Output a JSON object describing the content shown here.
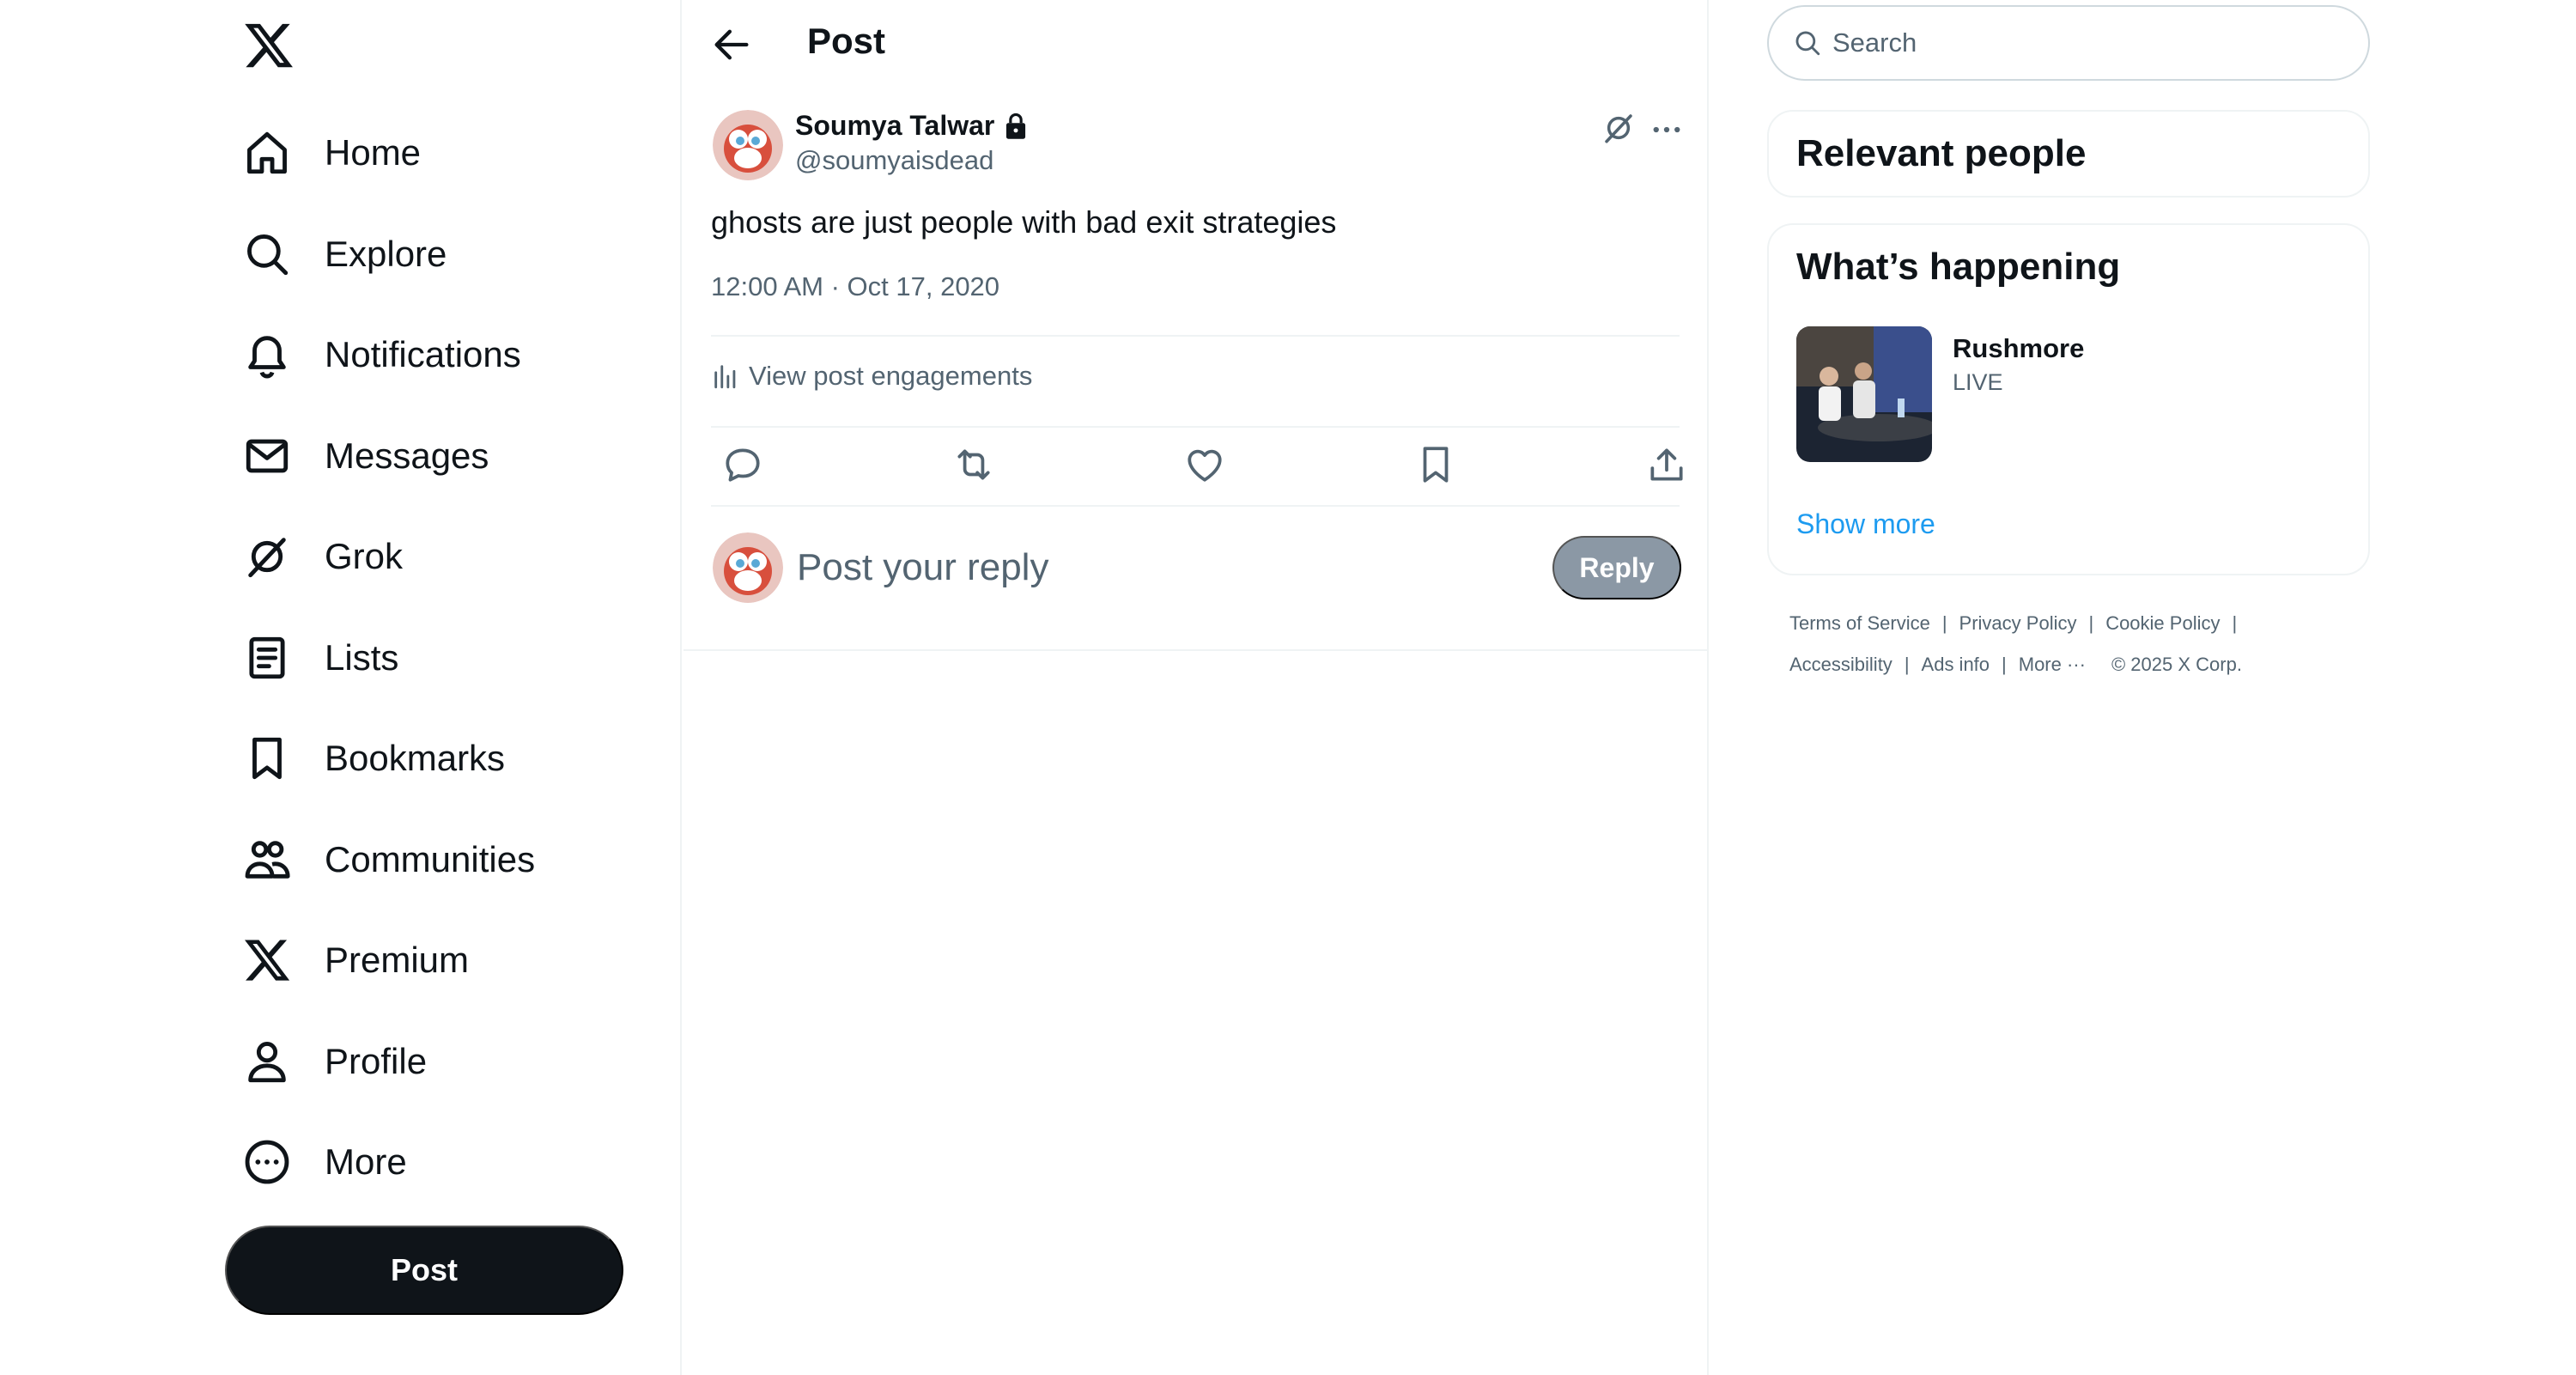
{
  "nav": {
    "items": [
      {
        "label": "Home",
        "icon": "home-icon"
      },
      {
        "label": "Explore",
        "icon": "search-icon"
      },
      {
        "label": "Notifications",
        "icon": "bell-icon"
      },
      {
        "label": "Messages",
        "icon": "envelope-icon"
      },
      {
        "label": "Grok",
        "icon": "grok-icon"
      },
      {
        "label": "Lists",
        "icon": "list-icon"
      },
      {
        "label": "Bookmarks",
        "icon": "bookmark-icon"
      },
      {
        "label": "Communities",
        "icon": "communities-icon"
      },
      {
        "label": "Premium",
        "icon": "x-logo-icon"
      },
      {
        "label": "Profile",
        "icon": "person-icon"
      },
      {
        "label": "More",
        "icon": "more-circle-icon"
      }
    ],
    "post_button": "Post"
  },
  "header": {
    "title": "Post"
  },
  "post": {
    "author_name": "Soumya Talwar",
    "handle": "@soumyaisdead",
    "text": "ghosts are just people with bad exit strategies",
    "timestamp": "12:00 AM · Oct 17, 2020",
    "engagements_label": "View post engagements"
  },
  "reply": {
    "placeholder": "Post your reply",
    "button": "Reply"
  },
  "search": {
    "placeholder": "Search"
  },
  "relevant_people": {
    "title": "Relevant people"
  },
  "whats_happening": {
    "title": "What’s happening",
    "trend": {
      "name": "Rushmore",
      "status": "LIVE"
    },
    "show_more": "Show more"
  },
  "footer": {
    "links_row1": [
      "Terms of Service",
      "Privacy Policy",
      "Cookie Policy"
    ],
    "links_row2": [
      "Accessibility",
      "Ads info"
    ],
    "more": "More ···",
    "copyright": "© 2025 X Corp."
  },
  "colors": {
    "text_primary": "#0f1419",
    "text_secondary": "#536471",
    "accent": "#1d9bf0",
    "border": "#eff3f4",
    "disabled_button": "#8b98a5"
  }
}
